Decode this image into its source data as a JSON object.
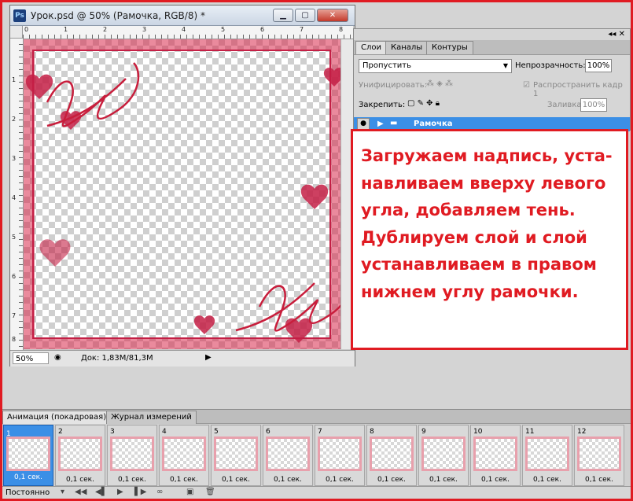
{
  "document": {
    "title": "Урок.psd @ 50% (Рамочка, RGB/8) *",
    "app_icon": "Ps",
    "zoom": "50%",
    "doc_info": "Док: 1,83M/81,3M",
    "ruler_h": [
      "0",
      "1",
      "2",
      "3",
      "4",
      "5",
      "6",
      "7",
      "8"
    ],
    "ruler_v": [
      "1",
      "2",
      "3",
      "4",
      "5",
      "6",
      "7",
      "8"
    ]
  },
  "layers_panel": {
    "tabs": [
      "Слои",
      "Каналы",
      "Контуры"
    ],
    "blend_mode": "Пропустить",
    "opacity_label": "Непрозрачность:",
    "opacity_value": "100%",
    "unify_label": "Унифицировать:",
    "propagate_label": "Распространить кадр 1",
    "lock_label": "Закрепить:",
    "fill_label": "Заливка:",
    "fill_value": "100%",
    "layer_name": "Рамочка"
  },
  "callout": {
    "lines": [
      "Загружаем надпись, уста-",
      "навливаем вверху левого",
      "угла, добавляем тень.",
      "Дублируем слой и слой",
      "устанавливаем в правом",
      "нижнем углу рамочки."
    ]
  },
  "animation": {
    "tabs": [
      "Анимация (покадровая)",
      "Журнал измерений"
    ],
    "frames": [
      {
        "num": "1",
        "time": "0,1 сек."
      },
      {
        "num": "2",
        "time": "0,1 сек."
      },
      {
        "num": "3",
        "time": "0,1 сек."
      },
      {
        "num": "4",
        "time": "0,1 сек."
      },
      {
        "num": "5",
        "time": "0,1 сек."
      },
      {
        "num": "6",
        "time": "0,1 сек."
      },
      {
        "num": "7",
        "time": "0,1 сек."
      },
      {
        "num": "8",
        "time": "0,1 сек."
      },
      {
        "num": "9",
        "time": "0,1 сек."
      },
      {
        "num": "10",
        "time": "0,1 сек."
      },
      {
        "num": "11",
        "time": "0,1 сек."
      },
      {
        "num": "12",
        "time": "0,1 сек."
      }
    ],
    "loop": "Постоянно"
  },
  "colors": {
    "accent_red": "#e01b22",
    "selection_blue": "#3b8fe6",
    "frame_pink": "#e8a0ac"
  }
}
